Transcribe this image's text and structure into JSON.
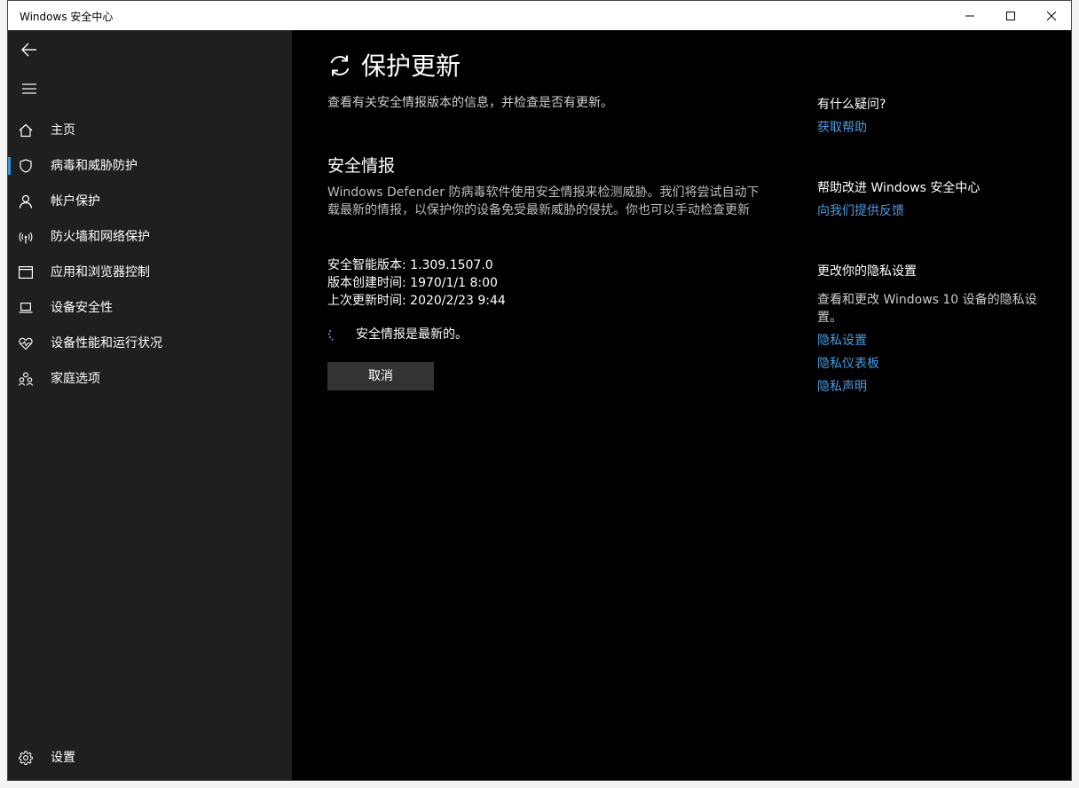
{
  "window": {
    "title": "Windows 安全中心"
  },
  "sidebar": {
    "items": [
      {
        "label": "主页",
        "icon": "home-icon"
      },
      {
        "label": "病毒和威胁防护",
        "icon": "shield-icon"
      },
      {
        "label": "帐户保护",
        "icon": "person-icon"
      },
      {
        "label": "防火墙和网络保护",
        "icon": "wifi-icon"
      },
      {
        "label": "应用和浏览器控制",
        "icon": "browser-icon"
      },
      {
        "label": "设备安全性",
        "icon": "laptop-icon"
      },
      {
        "label": "设备性能和运行状况",
        "icon": "heart-pulse-icon"
      },
      {
        "label": "家庭选项",
        "icon": "family-icon"
      }
    ],
    "settings_label": "设置",
    "selected": "病毒和威胁防护"
  },
  "main": {
    "title": "保护更新",
    "subtitle": "查看有关安全情报版本的信息，并检查是否有更新。",
    "section_title": "安全情报",
    "section_desc": "Windows Defender 防病毒软件使用安全情报来检测威胁。我们将尝试自动下载最新的情报，以保护你的设备免受最新威胁的侵扰。你也可以手动检查更新",
    "info": {
      "version": "安全智能版本: 1.309.1507.0",
      "created": "版本创建时间: 1970/1/1 8:00",
      "last_update": "上次更新时间: 2020/2/23 9:44"
    },
    "status": "安全情报是最新的。",
    "cancel_label": "取消"
  },
  "right": {
    "questions_title": "有什么疑问?",
    "get_help": "获取帮助",
    "improve_title": "帮助改进 Windows 安全中心",
    "feedback": "向我们提供反馈",
    "privacy_title": "更改你的隐私设置",
    "privacy_text": "查看和更改 Windows 10 设备的隐私设置。",
    "privacy_settings": "隐私设置",
    "privacy_dashboard": "隐私仪表板",
    "privacy_statement": "隐私声明"
  },
  "colors": {
    "accent": "#3a96dd",
    "link": "#4a9ae0",
    "sidebar_bg": "#1f1f1f",
    "main_bg": "#000000"
  }
}
